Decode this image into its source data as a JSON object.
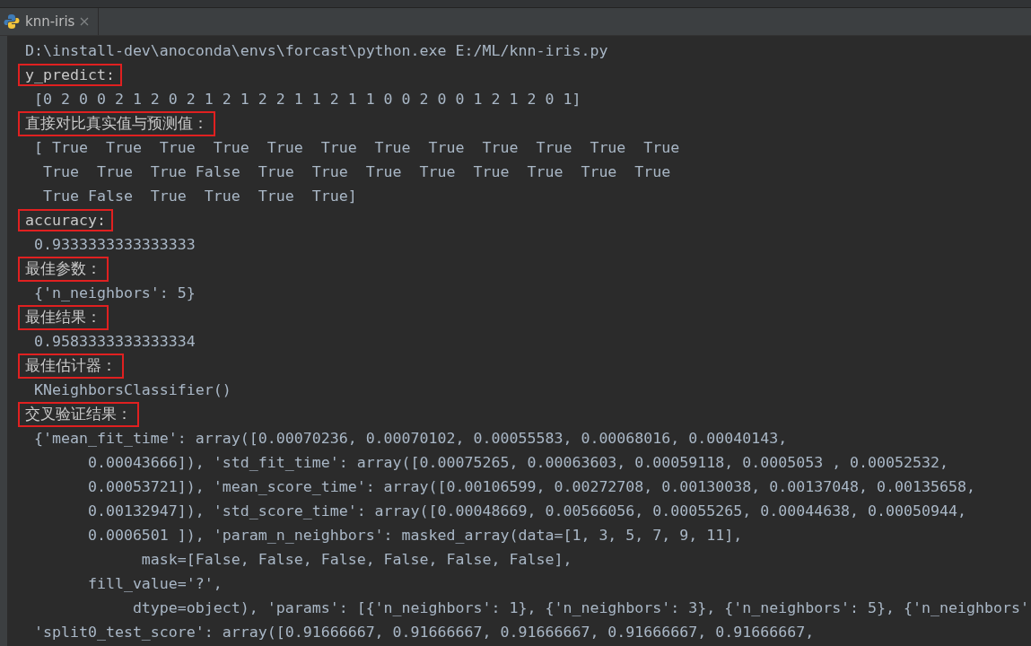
{
  "tab": {
    "title": "knn-iris"
  },
  "console": {
    "lines": [
      {
        "kind": "plain",
        "text": "D:\\install-dev\\anoconda\\envs\\forcast\\python.exe E:/ML/knn-iris.py"
      },
      {
        "kind": "marked",
        "text": "y_predict:"
      },
      {
        "kind": "plain",
        "text": " [0 2 0 0 2 1 2 0 2 1 2 1 2 2 1 1 2 1 1 0 0 2 0 0 1 2 1 2 0 1]"
      },
      {
        "kind": "marked",
        "text": "直接对比真实值与预测值："
      },
      {
        "kind": "plain",
        "text": " [ True  True  True  True  True  True  True  True  True  True  True  True"
      },
      {
        "kind": "plain",
        "text": "  True  True  True False  True  True  True  True  True  True  True  True"
      },
      {
        "kind": "plain",
        "text": "  True False  True  True  True  True]"
      },
      {
        "kind": "marked",
        "text": "accuracy:"
      },
      {
        "kind": "plain",
        "text": " 0.9333333333333333"
      },
      {
        "kind": "marked",
        "text": "最佳参数："
      },
      {
        "kind": "plain",
        "text": " {'n_neighbors': 5}"
      },
      {
        "kind": "marked",
        "text": "最佳结果："
      },
      {
        "kind": "plain",
        "text": " 0.9583333333333334"
      },
      {
        "kind": "marked",
        "text": "最佳估计器："
      },
      {
        "kind": "plain",
        "text": " KNeighborsClassifier()"
      },
      {
        "kind": "marked",
        "text": "交叉验证结果："
      },
      {
        "kind": "plain",
        "text": " {'mean_fit_time': array([0.00070236, 0.00070102, 0.00055583, 0.00068016, 0.00040143,"
      },
      {
        "kind": "plain",
        "text": "       0.00043666]), 'std_fit_time': array([0.00075265, 0.00063603, 0.00059118, 0.0005053 , 0.00052532,"
      },
      {
        "kind": "plain",
        "text": "       0.00053721]), 'mean_score_time': array([0.00106599, 0.00272708, 0.00130038, 0.00137048, 0.00135658,"
      },
      {
        "kind": "plain",
        "text": "       0.00132947]), 'std_score_time': array([0.00048669, 0.00566056, 0.00055265, 0.00044638, 0.00050944,"
      },
      {
        "kind": "plain",
        "text": "       0.0006501 ]), 'param_n_neighbors': masked_array(data=[1, 3, 5, 7, 9, 11],"
      },
      {
        "kind": "plain",
        "text": "             mask=[False, False, False, False, False, False],"
      },
      {
        "kind": "plain",
        "text": "       fill_value='?',"
      },
      {
        "kind": "plain",
        "text": "            dtype=object), 'params': [{'n_neighbors': 1}, {'n_neighbors': 3}, {'n_neighbors': 5}, {'n_neighbors'"
      },
      {
        "kind": "plain",
        "text": " 'split0_test_score': array([0.91666667, 0.91666667, 0.91666667, 0.91666667, 0.91666667,"
      }
    ]
  }
}
